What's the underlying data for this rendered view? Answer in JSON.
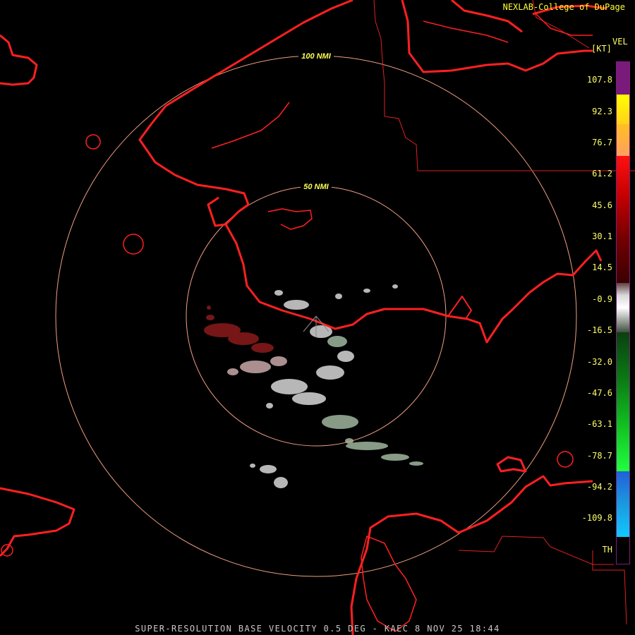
{
  "header": {
    "credit": "NEXLAB-College of DuPage"
  },
  "map": {
    "range_rings": [
      {
        "label": "50 NMI"
      },
      {
        "label": "100 NMI"
      }
    ],
    "colors": {
      "coastline": "#ff2020",
      "boundary": "#e02020",
      "ring": "#f0a080",
      "ring_label": "#ffff55"
    }
  },
  "legend": {
    "product": "VEL",
    "unit": "[KT]",
    "ticks": [
      "107.8",
      "92.3",
      "76.7",
      "61.2",
      "45.6",
      "30.1",
      "14.5",
      "-0.9",
      "-16.5",
      "-32.0",
      "-47.6",
      "-63.1",
      "-78.7",
      "-94.2",
      "-109.8",
      "TH"
    ]
  },
  "footer": {
    "caption": "SUPER-RESOLUTION BASE VELOCITY 0.5 DEG - KAEC 8 NOV 25 18:44"
  }
}
